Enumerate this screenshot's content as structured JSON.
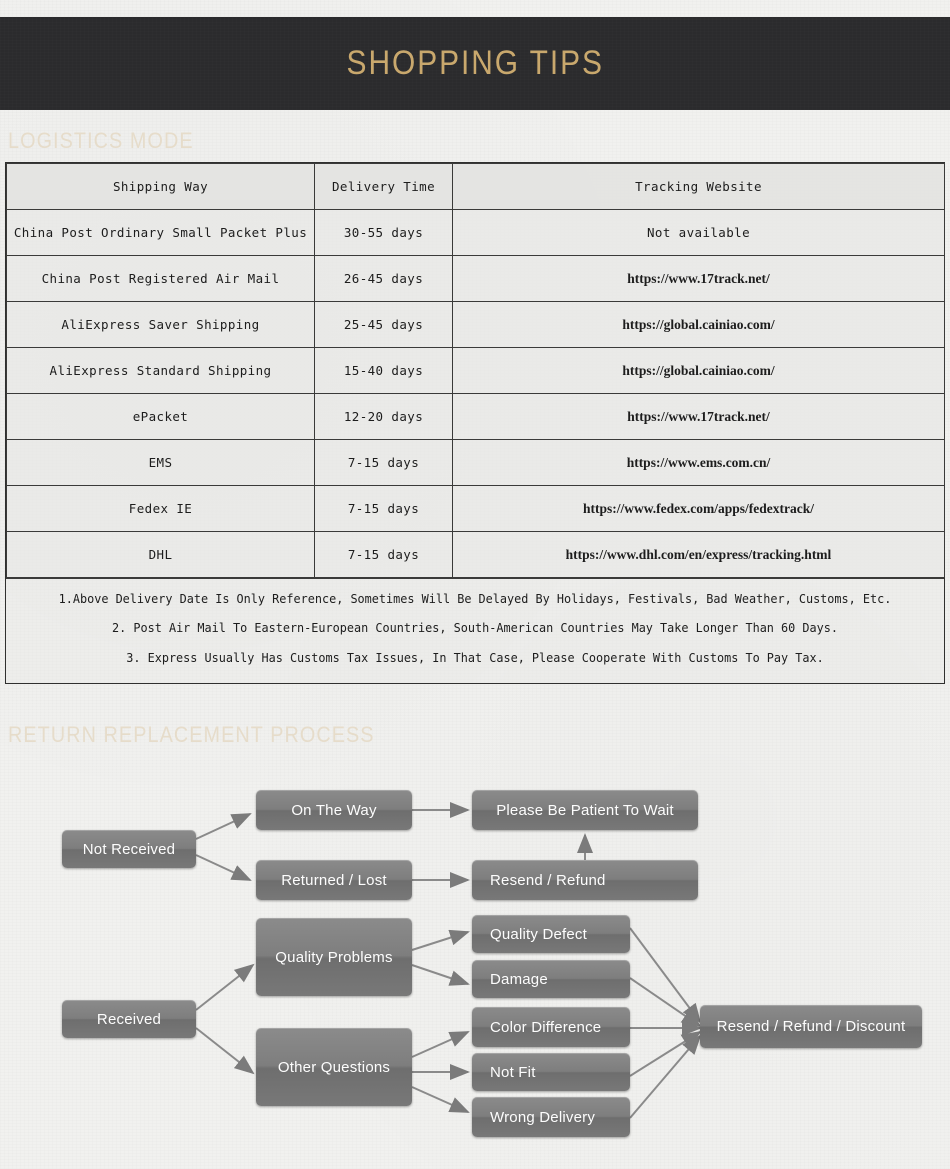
{
  "banner": {
    "title": "SHOPPING TIPS"
  },
  "sections": {
    "logistics_heading": "LOGISTICS MODE",
    "return_heading": "RETURN REPLACEMENT PROCESS"
  },
  "colors": {
    "banner_bg": "#2b2b2d",
    "banner_text": "#c9a86d",
    "section_heading": "#e6dcca",
    "page_bg": "#f1f1ef",
    "node_fill": "#7e7e7e",
    "node_text": "#fdfdfd",
    "table_border": "#3a3a39"
  },
  "table": {
    "headers": [
      "Shipping Way",
      "Delivery Time",
      "Tracking Website"
    ],
    "rows": [
      {
        "way": "China Post Ordinary Small Packet Plus",
        "time": "30-55 days",
        "url": "Not available",
        "is_url": false
      },
      {
        "way": "China Post Registered Air Mail",
        "time": "26-45 days",
        "url": "https://www.17track.net/",
        "is_url": true
      },
      {
        "way": "AliExpress Saver Shipping",
        "time": "25-45 days",
        "url": "https://global.cainiao.com/",
        "is_url": true
      },
      {
        "way": "AliExpress Standard Shipping",
        "time": "15-40 days",
        "url": "https://global.cainiao.com/",
        "is_url": true
      },
      {
        "way": "ePacket",
        "time": "12-20 days",
        "url": "https://www.17track.net/",
        "is_url": true
      },
      {
        "way": "EMS",
        "time": "7-15 days",
        "url": "https://www.ems.com.cn/",
        "is_url": true
      },
      {
        "way": "Fedex IE",
        "time": "7-15 days",
        "url": "https://www.fedex.com/apps/fedextrack/",
        "is_url": true
      },
      {
        "way": "DHL",
        "time": "7-15 days",
        "url": "https://www.dhl.com/en/express/tracking.html",
        "is_url": true
      }
    ],
    "notes": [
      "1.Above Delivery Date Is Only Reference, Sometimes Will Be Delayed By Holidays, Festivals, Bad Weather, Customs, Etc.",
      "2. Post Air Mail To Eastern-European Countries, South-American Countries May Take Longer Than 60 Days.",
      "3. Express Usually Has Customs Tax Issues, In That Case, Please Cooperate With Customs To Pay Tax."
    ]
  },
  "flowchart": {
    "nodes": {
      "not_received": "Not Received",
      "on_the_way": "On The Way",
      "returned_lost": "Returned / Lost",
      "please_wait": "Please Be Patient To Wait",
      "resend_refund": "Resend / Refund",
      "received": "Received",
      "quality_problems": "Quality Problems",
      "other_questions": "Other Questions",
      "quality_defect": "Quality Defect",
      "damage": "Damage",
      "color_difference": "Color Difference",
      "not_fit": "Not Fit",
      "wrong_delivery": "Wrong Delivery",
      "final": "Resend / Refund / Discount"
    }
  }
}
